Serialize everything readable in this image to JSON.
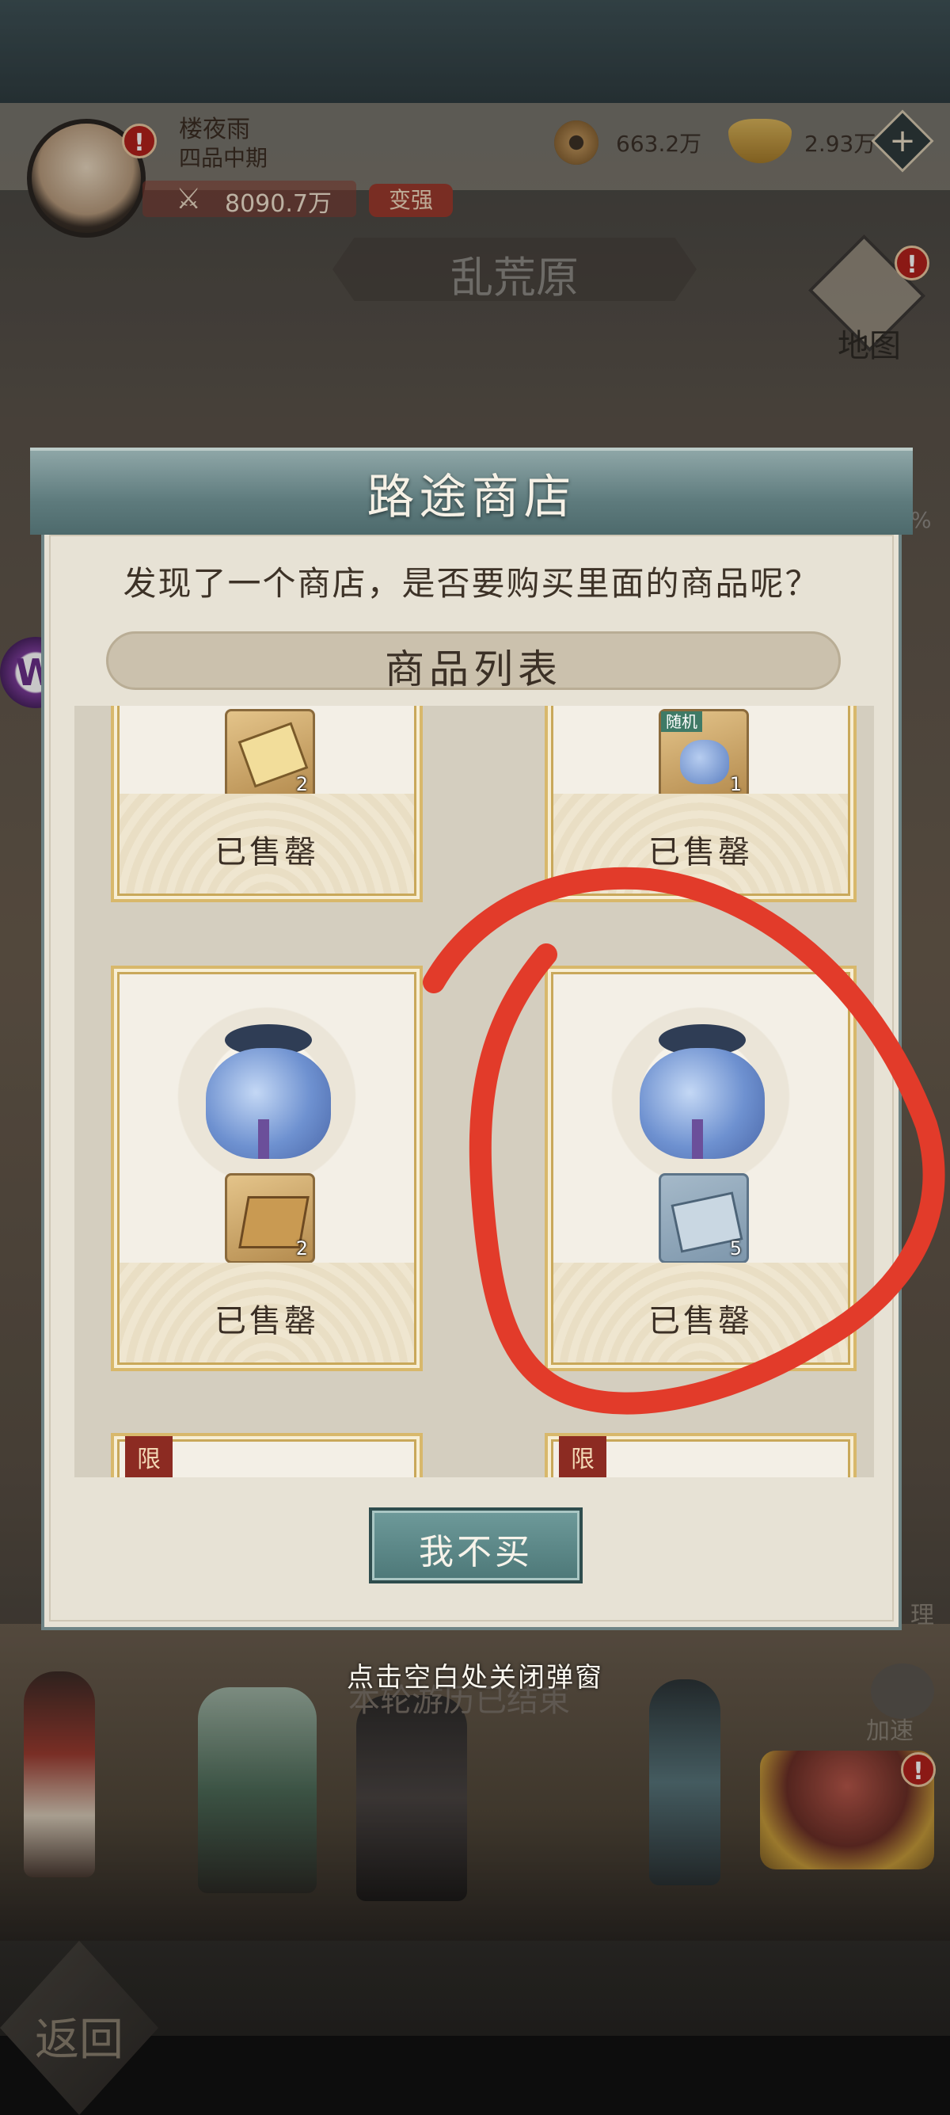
{
  "player": {
    "name": "楼夜雨",
    "rank": "四品中期",
    "power": "8090.7万",
    "upgrade_label": "变强",
    "alert": "!"
  },
  "currency": {
    "coins": "663.2万",
    "ingots": "2.93万",
    "add_symbol": "+"
  },
  "area": {
    "title": "乱荒原"
  },
  "map": {
    "label": "地图",
    "alert": "!"
  },
  "side": {
    "percent": "%"
  },
  "overlay": {
    "w_icon": "W"
  },
  "scene": {
    "ended_text": "本轮游历已结束",
    "right_label_1": "理",
    "right_label_2": "加速",
    "return_label": "返回",
    "chest_alert": "!"
  },
  "modal": {
    "title": "路途商店",
    "prompt": "发现了一个商店，是否要购买里面的商品呢？",
    "list_title": "商品列表",
    "items": [
      {
        "status": "已售罄",
        "qty": "2",
        "tag": ""
      },
      {
        "status": "已售罄",
        "qty": "1",
        "tag": "随机"
      },
      {
        "status": "已售罄",
        "qty": "2",
        "tag": ""
      },
      {
        "status": "已售罄",
        "qty": "5",
        "tag": ""
      },
      {
        "tag": "限"
      },
      {
        "tag": "限"
      }
    ],
    "decline_label": "我不买"
  },
  "close_hint": "点击空白处关闭弹窗",
  "colors": {
    "annotation": "#e23b2a",
    "header": "#5e7b7d",
    "card_border": "#d8b86b"
  }
}
